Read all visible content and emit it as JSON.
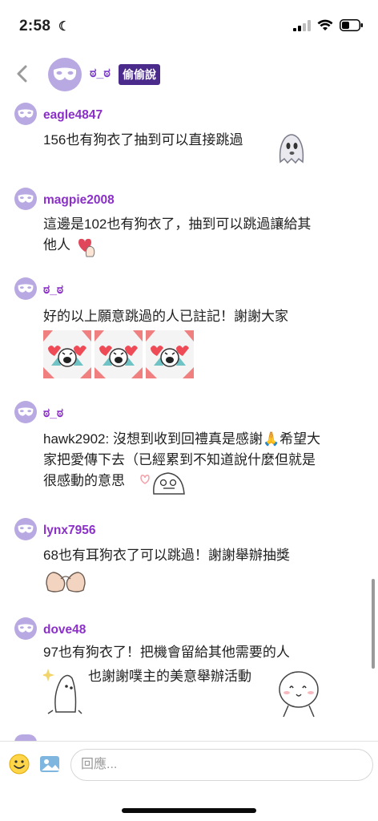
{
  "status_bar": {
    "time": "2:58"
  },
  "header": {
    "name": "ಠ_ಠ",
    "badge": "偷偷說"
  },
  "comments": [
    {
      "username": "eagle4847",
      "lines": [
        "156也有狗衣了抽到可以直接跳過"
      ]
    },
    {
      "username": "magpie2008",
      "lines": [
        "這邊是102也有狗衣了，抽到可以跳過讓給其",
        "他人"
      ]
    },
    {
      "username": "ಠ_ಠ",
      "lines": [
        "好的以上願意跳過的人已註記！謝謝大家"
      ]
    },
    {
      "username": "ಠ_ಠ",
      "lines": [
        "hawk2902: 沒想到收到回禮真是感謝🙏希望大",
        "家把愛傳下去（已經累到不知道說什麼但就是",
        "很感動的意思"
      ]
    },
    {
      "username": "lynx7956",
      "lines": [
        "68也有耳狗衣了可以跳過！謝謝舉辦抽獎"
      ]
    },
    {
      "username": "dove48",
      "lines": [
        "97也有狗衣了！把機會留給其他需要的人",
        "也謝謝噗主的美意舉辦活動"
      ]
    }
  ],
  "input": {
    "placeholder": "回應..."
  },
  "colors": {
    "username": "#8b2fc9",
    "avatar": "#b9a9e3",
    "badge_bg": "#4a2a8a"
  }
}
